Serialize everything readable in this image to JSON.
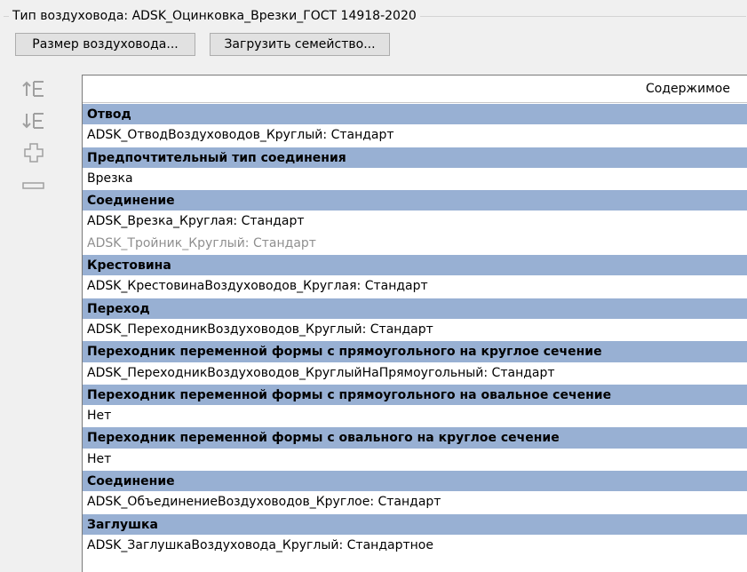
{
  "group": {
    "title": "Тип воздуховода: ADSK_Оцинковка_Врезки_ГОСТ 14918-2020"
  },
  "buttons": {
    "duct_size": "Размер воздуховода...",
    "load_family": "Загрузить семейство..."
  },
  "side_icons": [
    "move-up-icon",
    "move-down-icon",
    "add-icon",
    "remove-icon"
  ],
  "table": {
    "header": "Содержимое",
    "rows": [
      {
        "type": "category",
        "text": "Отвод"
      },
      {
        "type": "item",
        "text": "ADSK_ОтводВоздуховодов_Круглый: Стандарт"
      },
      {
        "type": "category",
        "text": "Предпочтительный тип соединения"
      },
      {
        "type": "item",
        "text": "Врезка"
      },
      {
        "type": "category",
        "text": "Соединение"
      },
      {
        "type": "item",
        "text": "ADSK_Врезка_Круглая: Стандарт"
      },
      {
        "type": "item-disabled",
        "text": "ADSK_Тройник_Круглый: Стандарт"
      },
      {
        "type": "category",
        "text": "Крестовина"
      },
      {
        "type": "item",
        "text": "ADSK_КрестовинаВоздуховодов_Круглая: Стандарт"
      },
      {
        "type": "category",
        "text": "Переход"
      },
      {
        "type": "item",
        "text": "ADSK_ПереходникВоздуховодов_Круглый: Стандарт"
      },
      {
        "type": "category",
        "text": "Переходник переменной формы с прямоугольного на круглое сечение"
      },
      {
        "type": "item",
        "text": "ADSK_ПереходникВоздуховодов_КруглыйНаПрямоугольный: Стандарт"
      },
      {
        "type": "category",
        "text": "Переходник переменной формы с прямоугольного на овальное сечение"
      },
      {
        "type": "item",
        "text": "Нет"
      },
      {
        "type": "category",
        "text": "Переходник переменной формы с овального на круглое сечение"
      },
      {
        "type": "item",
        "text": "Нет"
      },
      {
        "type": "category",
        "text": "Соединение"
      },
      {
        "type": "item",
        "text": "ADSK_ОбъединениеВоздуховодов_Круглое: Стандарт"
      },
      {
        "type": "category",
        "text": "Заглушка"
      },
      {
        "type": "item",
        "text": "ADSK_ЗаглушкаВоздуховода_Круглый: Стандартное"
      }
    ]
  },
  "colors": {
    "category_bg": "#98b0d3",
    "disabled_text": "#8f8f8f",
    "icon_gray": "#a0a0a0"
  }
}
